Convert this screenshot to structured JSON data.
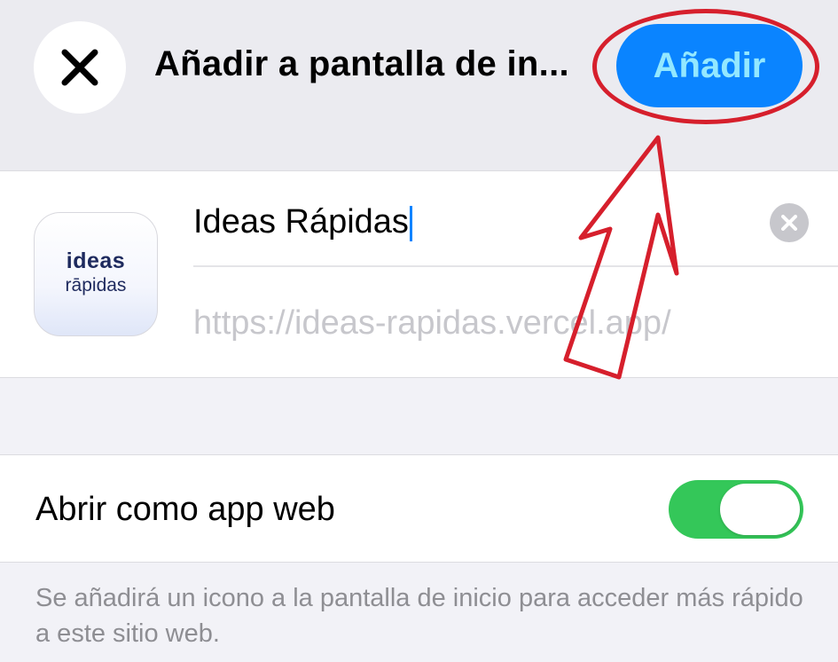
{
  "header": {
    "close_icon": "close-icon",
    "title": "Añadir a pantalla de in...",
    "add_label": "Añadir"
  },
  "app": {
    "icon_line1": "ideas",
    "icon_line2": "rāpidas",
    "name_value": "Ideas Rápidas",
    "clear_icon": "clear-icon",
    "url": "https://ideas-rapidas.vercel.app/"
  },
  "settings": {
    "open_as_web_app_label": "Abrir como app web",
    "open_as_web_app_on": true
  },
  "footer": {
    "text": "Se añadirá un icono a la pantalla de inicio para acceder más rápido a este sitio web."
  },
  "colors": {
    "accent": "#0a84ff",
    "toggle_on": "#34c759",
    "annotation": "#d61f2c"
  }
}
